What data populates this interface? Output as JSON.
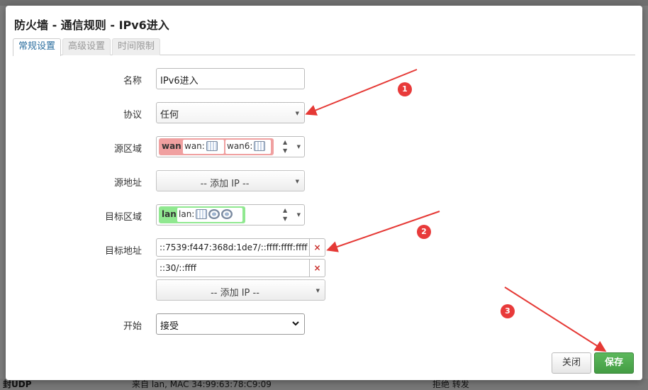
{
  "dialog": {
    "title": "防火墙 - 通信规则 - IPv6进入",
    "tabs": [
      {
        "label": "常规设置",
        "active": true
      },
      {
        "label": "高级设置",
        "active": false
      },
      {
        "label": "时间限制",
        "active": false
      }
    ]
  },
  "form": {
    "name": {
      "label": "名称",
      "value": "IPv6进入"
    },
    "protocol": {
      "label": "协议",
      "value": "任何"
    },
    "src_zone": {
      "label": "源区域",
      "zone": "wan",
      "chips": [
        "wan:",
        "wan6:"
      ],
      "color": "#f0a0a0"
    },
    "src_addr": {
      "label": "源地址",
      "value": "-- 添加 IP --"
    },
    "dest_zone": {
      "label": "目标区域",
      "zone": "lan",
      "chips": [
        "lan:"
      ],
      "color": "#90e890"
    },
    "dest_addr": {
      "label": "目标地址",
      "entries": [
        "::7539:f447:368d:1de7/::ffff:ffff:ffff:ffff",
        "::30/::ffff"
      ],
      "remove_symbol": "×",
      "add_label": "-- 添加 IP --"
    },
    "action": {
      "label": "开始",
      "value": "接受"
    }
  },
  "buttons": {
    "close": "关闭",
    "save": "保存"
  },
  "annotations": [
    "1",
    "2",
    "3"
  ],
  "background_page": {
    "left_text": "封UDP",
    "center_text": "来自 lan, MAC 34:99:63:78:C9:09",
    "right_text": "拒绝 转发"
  },
  "colors": {
    "accent_tab": "#2a6d9e",
    "save_green": "#449d44",
    "remove_red": "#c9302c",
    "annotation_red": "#e83a3a"
  }
}
